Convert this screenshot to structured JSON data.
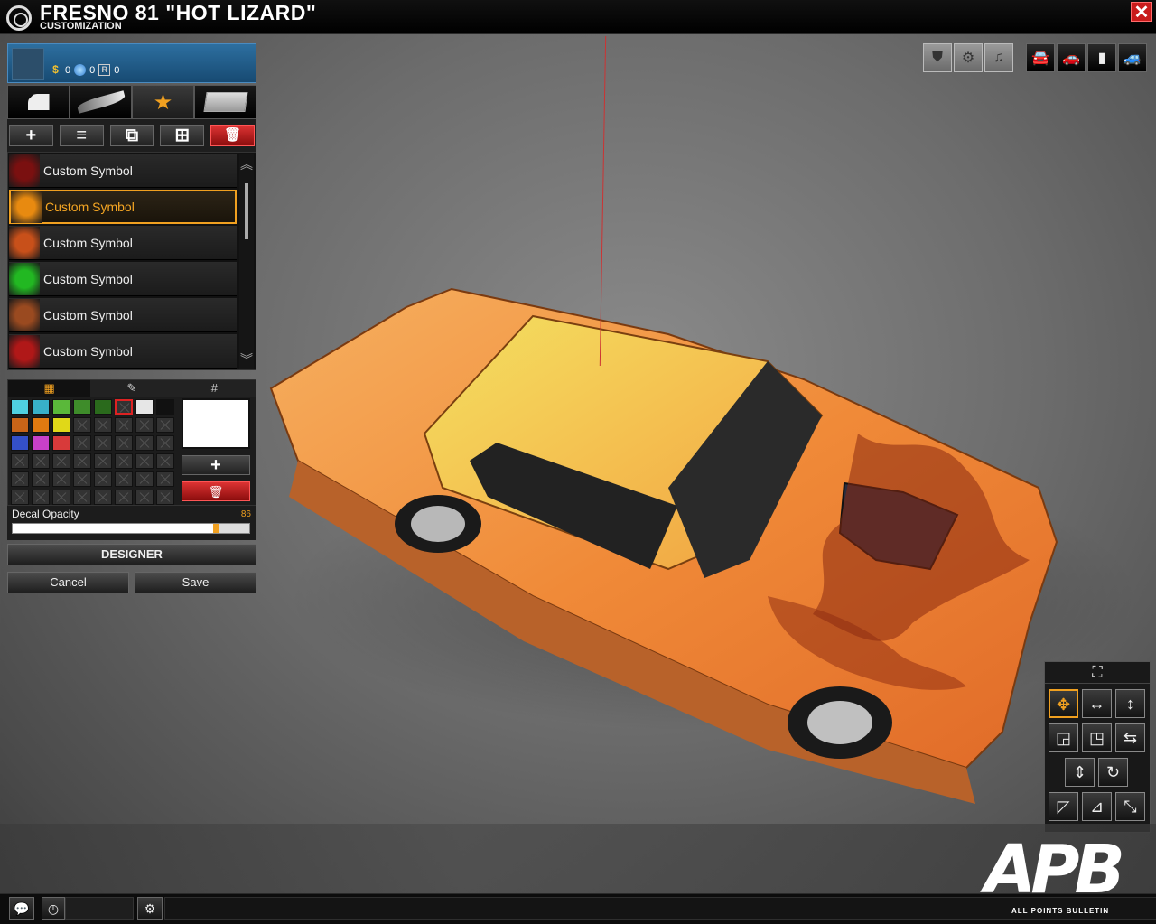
{
  "window": {
    "title": "FRESNO 81 \"HOT LIZARD\"",
    "subtitle": "CUSTOMIZATION",
    "close_symbol": "✕"
  },
  "currency": {
    "s_icon": "$",
    "s_value": "0",
    "o_value": "0",
    "r_icon": "R",
    "r_value": "0"
  },
  "tabs": [
    {
      "name": "door-tab-icon",
      "active": false
    },
    {
      "name": "brush-tab-icon",
      "active": false
    },
    {
      "name": "star-tab-icon",
      "label": "★",
      "active": true
    },
    {
      "name": "plate-tab-icon",
      "active": false
    }
  ],
  "actions": [
    {
      "name": "add-layer-button",
      "label": "+"
    },
    {
      "name": "align-layer-button",
      "label": "≡"
    },
    {
      "name": "duplicate-layer-button",
      "label": "⧉"
    },
    {
      "name": "paste-layer-button",
      "label": "⊞"
    },
    {
      "name": "delete-layer-button",
      "label": "🗑"
    }
  ],
  "symbols": {
    "items": [
      {
        "label": "Custom Symbol",
        "thumb": "#7a1010",
        "selected": false
      },
      {
        "label": "Custom Symbol",
        "thumb": "#e88a10",
        "selected": true
      },
      {
        "label": "Custom Symbol",
        "thumb": "#c8501a",
        "selected": false
      },
      {
        "label": "Custom Symbol",
        "thumb": "#22b822",
        "selected": false
      },
      {
        "label": "Custom Symbol",
        "thumb": "#9a4a20",
        "selected": false
      },
      {
        "label": "Custom Symbol",
        "thumb": "#b01818",
        "selected": false
      }
    ],
    "scroll_up": "︽",
    "scroll_down": "︾"
  },
  "color_tabs": [
    "▦",
    "✎",
    "#"
  ],
  "palette": [
    "#4fd0e0",
    "#38b0c8",
    "#5ab83a",
    "#3e8c2a",
    "#2a6a1c",
    "empty-selected",
    "#e6e6e6",
    "#111111",
    "#c86418",
    "#e07a10",
    "#e0d818",
    "empty",
    "empty",
    "empty",
    "empty",
    "empty",
    "#3450c8",
    "#c840c8",
    "#d83a3a",
    "empty",
    "empty",
    "empty",
    "empty",
    "empty",
    "empty",
    "empty",
    "empty",
    "empty",
    "empty",
    "empty",
    "empty",
    "empty",
    "empty",
    "empty",
    "empty",
    "empty",
    "empty",
    "empty",
    "empty",
    "empty",
    "empty",
    "empty",
    "empty",
    "empty",
    "empty",
    "empty",
    "empty",
    "empty"
  ],
  "color_add_label": "+",
  "color_delete_label": "🗑",
  "opacity": {
    "label": "Decal Opacity",
    "value": "86",
    "fraction": 0.86
  },
  "buttons": {
    "designer": "DESIGNER",
    "cancel": "Cancel",
    "save": "Save"
  },
  "view_icons": [
    {
      "name": "paint-view-icon",
      "glyph": "⛊",
      "dark": false
    },
    {
      "name": "engine-view-icon",
      "glyph": "⚙",
      "dark": false
    },
    {
      "name": "horn-view-icon",
      "glyph": "♫",
      "dark": false
    },
    {
      "name": "car-top-view-icon",
      "glyph": "🚘",
      "dark": true
    },
    {
      "name": "car-front-view-icon",
      "glyph": "🚗",
      "dark": true
    },
    {
      "name": "car-overhead-view-icon",
      "glyph": "▮",
      "dark": true
    },
    {
      "name": "car-side-view-icon",
      "glyph": "🚙",
      "dark": true
    }
  ],
  "tools": {
    "header_icon": "⛶",
    "rows": [
      [
        {
          "name": "move-tool",
          "glyph": "✥",
          "active": true
        },
        {
          "name": "move-horizontal-tool",
          "glyph": "↔",
          "active": false
        },
        {
          "name": "move-vertical-tool",
          "glyph": "↕",
          "active": false
        }
      ],
      [
        {
          "name": "scale-tool",
          "glyph": "◲",
          "active": false
        },
        {
          "name": "scale-alt-tool",
          "glyph": "◳",
          "active": false
        },
        {
          "name": "flip-tool",
          "glyph": "⇆",
          "active": false
        }
      ],
      [
        {
          "name": "stretch-tool",
          "glyph": "⇕",
          "active": false
        },
        {
          "name": "rotate-tool",
          "glyph": "↻",
          "active": false
        }
      ],
      [
        {
          "name": "skew-tool",
          "glyph": "◸",
          "active": false
        },
        {
          "name": "mirror-tool",
          "glyph": "⊿",
          "active": false
        },
        {
          "name": "shear-tool",
          "glyph": "⤡",
          "active": false
        }
      ]
    ]
  },
  "taskbar": {
    "chat": "💬",
    "clock": "◷",
    "settings": "⚙"
  },
  "logo": {
    "text": "APB",
    "subtitle": "ALL POINTS BULLETIN"
  },
  "colors": {
    "accent": "#f0a020",
    "danger": "#c81b1b",
    "car_body": "#f08a30"
  }
}
